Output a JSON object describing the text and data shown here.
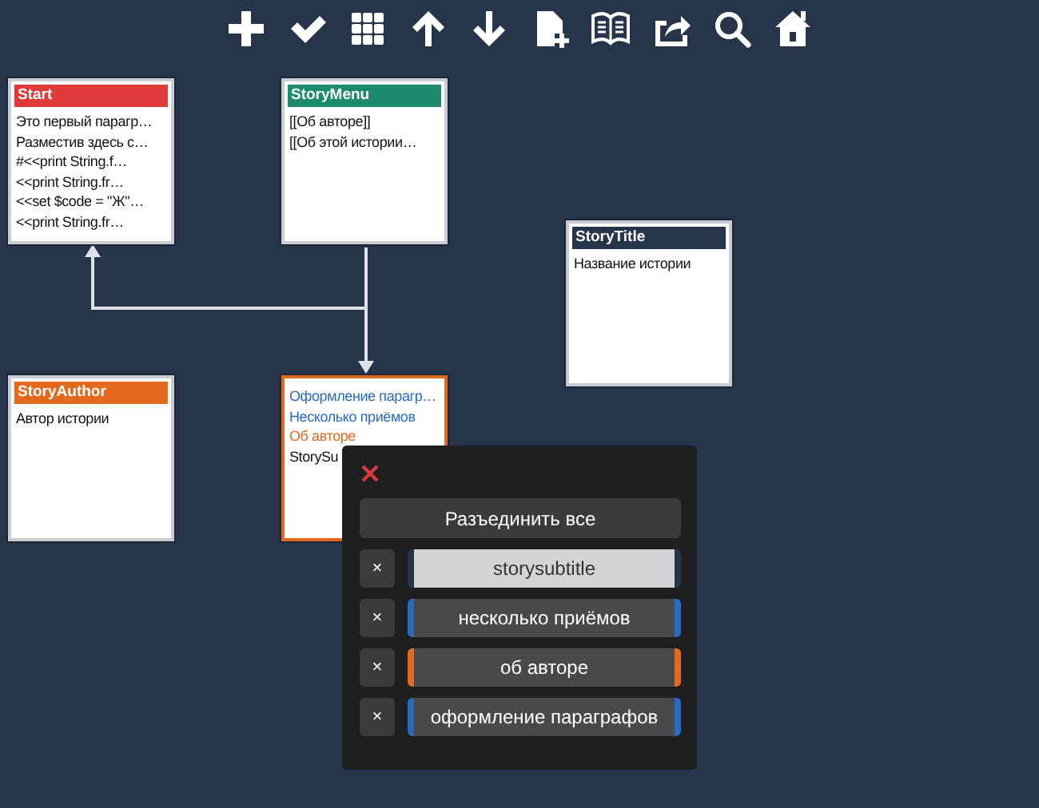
{
  "toolbar": {
    "buttons": [
      {
        "kind": "add"
      },
      {
        "kind": "check"
      },
      {
        "kind": "grid"
      },
      {
        "kind": "up"
      },
      {
        "kind": "down"
      },
      {
        "kind": "newfile"
      },
      {
        "kind": "book"
      },
      {
        "kind": "share"
      },
      {
        "kind": "search"
      },
      {
        "kind": "home"
      }
    ]
  },
  "passages": [
    {
      "title": "Start",
      "color": "#e0393a",
      "selected": false,
      "lines": [
        {
          "text": "Это первый парагр…",
          "color": "#111111"
        },
        {
          "text": "Разместив здесь с…",
          "color": "#111111"
        },
        {
          "text": "#<<print String.f…",
          "color": "#111111"
        },
        {
          "text": "<<print String.fr…",
          "color": "#111111"
        },
        {
          "text": "<<set $code = \"Ж\"…",
          "color": "#111111"
        },
        {
          "text": "<<print String.fr…",
          "color": "#111111"
        }
      ]
    },
    {
      "title": "StoryMenu",
      "color": "#1e8a6e",
      "selected": false,
      "lines": [
        {
          "text": "[[Об авторе]]",
          "color": "#111111"
        },
        {
          "text": "[[Об этой истории…",
          "color": "#111111"
        }
      ]
    },
    {
      "title": "StoryTitle",
      "color": "#26354a",
      "selected": false,
      "lines": [
        {
          "text": "Название истории",
          "color": "#111111"
        }
      ]
    },
    {
      "title": "StoryAuthor",
      "color": "#e2691e",
      "selected": false,
      "lines": [
        {
          "text": "Автор истории",
          "color": "#111111"
        }
      ]
    },
    {
      "color": "#e2691e",
      "selected": true,
      "lines": [
        {
          "text": "Оформление парагр…",
          "color": "#2a6bbd"
        },
        {
          "text": "Несколько приёмов",
          "color": "#2a6bbd"
        },
        {
          "text": "Об авторе",
          "color": "#e2691e"
        },
        {
          "text": "StorySu",
          "color": "#111111"
        }
      ]
    }
  ],
  "popup": {
    "unlink_all": "Разъединить все",
    "tags": [
      {
        "remove": "×",
        "label": "storysubtitle",
        "color": "#26354a",
        "selected": true
      },
      {
        "remove": "×",
        "label": "несколько приёмов",
        "color": "#2a6bbd",
        "selected": false
      },
      {
        "remove": "×",
        "label": "об авторе",
        "color": "#e2691e",
        "selected": false
      },
      {
        "remove": "×",
        "label": "оформление параграфов",
        "color": "#2a6bbd",
        "selected": false
      }
    ]
  }
}
